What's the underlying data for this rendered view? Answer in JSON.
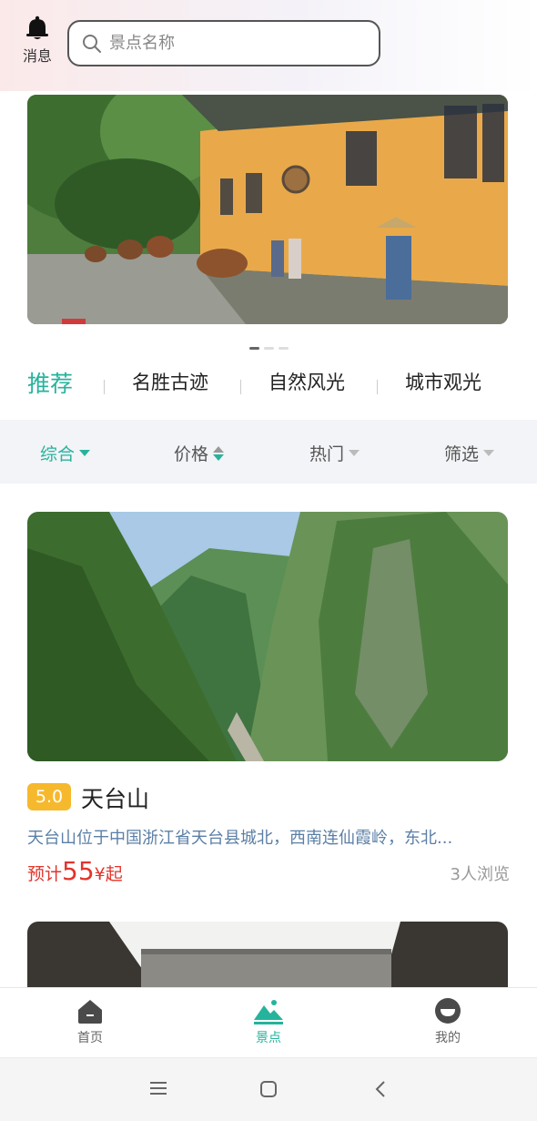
{
  "header": {
    "bell_label": "消息",
    "search_placeholder": "景点名称"
  },
  "banner": {
    "slides": 3,
    "active_slide": 1
  },
  "category_tabs": [
    {
      "label": "推荐",
      "active": true
    },
    {
      "label": "名胜古迹",
      "active": false
    },
    {
      "label": "自然风光",
      "active": false
    },
    {
      "label": "城市观光",
      "active": false
    }
  ],
  "sort_bar": [
    {
      "label": "综合",
      "active": true,
      "icon": "caret-down-icon"
    },
    {
      "label": "价格",
      "active": false,
      "icon": "sort-updown-icon"
    },
    {
      "label": "热门",
      "active": false,
      "icon": "caret-down-icon"
    },
    {
      "label": "筛选",
      "active": false,
      "icon": "caret-down-icon"
    }
  ],
  "cards": [
    {
      "score": "5.0",
      "title": "天台山",
      "description": "天台山位于中国浙江省天台县城北，西南连仙霞岭，东北...",
      "price_prefix": "预计",
      "price_value": "55",
      "price_suffix": "¥起",
      "views": "3人浏览"
    }
  ],
  "bottom_nav": [
    {
      "label": "首页",
      "icon": "home-icon",
      "active": false
    },
    {
      "label": "景点",
      "icon": "mountain-icon",
      "active": true
    },
    {
      "label": "我的",
      "icon": "profile-icon",
      "active": false
    }
  ],
  "colors": {
    "accent": "#26b39c",
    "price": "#e2342b",
    "badge": "#f6b92d",
    "description": "#5b7fa6"
  }
}
